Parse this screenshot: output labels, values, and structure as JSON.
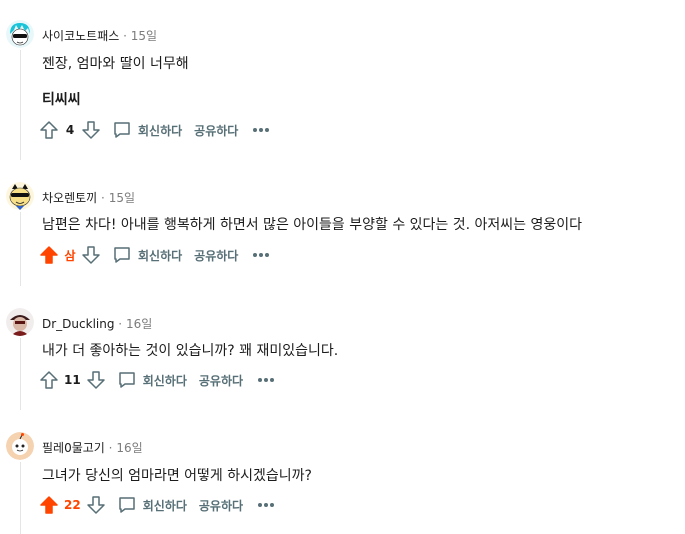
{
  "comments": [
    {
      "author": "사이코노트패스",
      "time": "15일",
      "lines": [
        "젠장, 엄마와 딸이 너무해"
      ],
      "bold_line": "티씨씨",
      "score": "4",
      "upvoted": false,
      "reply_label": "회신하다",
      "share_label": "공유하다"
    },
    {
      "author": "차오렌토끼",
      "time": "15일",
      "lines": [
        "남편은 차다! 아내를 행복하게 하면서 많은 아이들을 부양할 수 있다는 것. 아저씨는 영웅이다"
      ],
      "score": "삼",
      "upvoted": true,
      "reply_label": "회신하다",
      "share_label": "공유하다"
    },
    {
      "author": "Dr_Duckling",
      "time": "16일",
      "lines": [
        "내가 더 좋아하는 것이 있습니까? 꽤 재미있습니다."
      ],
      "score": "11",
      "upvoted": false,
      "reply_label": "회신하다",
      "share_label": "공유하다"
    },
    {
      "author": "필레0물고기",
      "time": "16일",
      "lines": [
        "그녀가 당신의 엄마라면 어떻게 하시겠습니까?"
      ],
      "score": "22",
      "upvoted": true,
      "reply_label": "회신하다",
      "share_label": "공유하다"
    }
  ],
  "separator": "·",
  "colors": {
    "upvote": "#ff4500",
    "meta": "#7c7c7c",
    "action": "#576f76",
    "thread": "#e5e5e5"
  }
}
